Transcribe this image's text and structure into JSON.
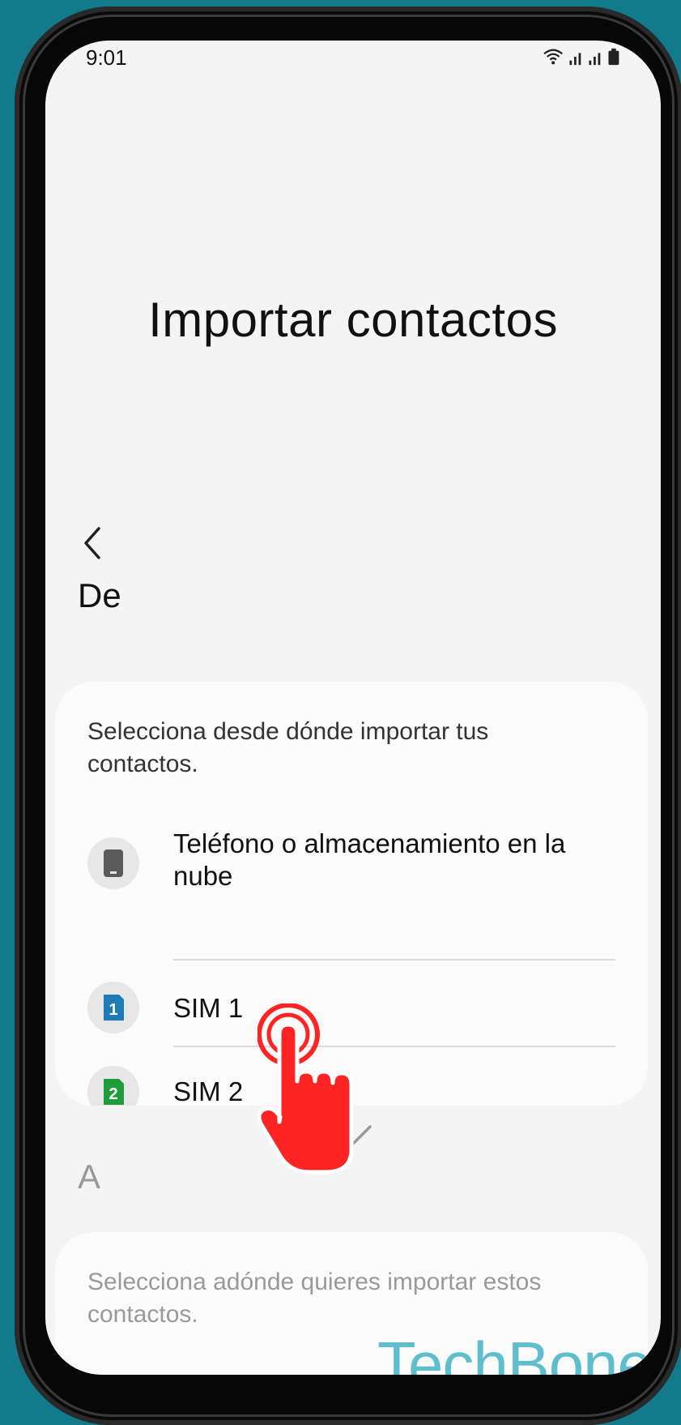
{
  "status_bar": {
    "time": "9:01"
  },
  "page": {
    "title": "Importar contactos"
  },
  "from_section": {
    "header": "De",
    "description": "Selecciona desde dónde importar tus contactos.",
    "options": [
      {
        "label": "Teléfono o almacenamiento en la nube",
        "icon": "phone-icon"
      },
      {
        "label": "SIM 1",
        "icon": "sim1-icon",
        "badge": "1",
        "color": "#1e7bb5"
      },
      {
        "label": "SIM 2",
        "icon": "sim2-icon",
        "badge": "2",
        "color": "#1f9d3a"
      }
    ]
  },
  "to_section": {
    "header": "A",
    "description": "Selecciona adónde quieres importar estos contactos."
  },
  "watermark": "TechBone",
  "colors": {
    "background": "#137a8c",
    "tap_hand": "#ff2424",
    "watermark": "#5fbecd"
  }
}
